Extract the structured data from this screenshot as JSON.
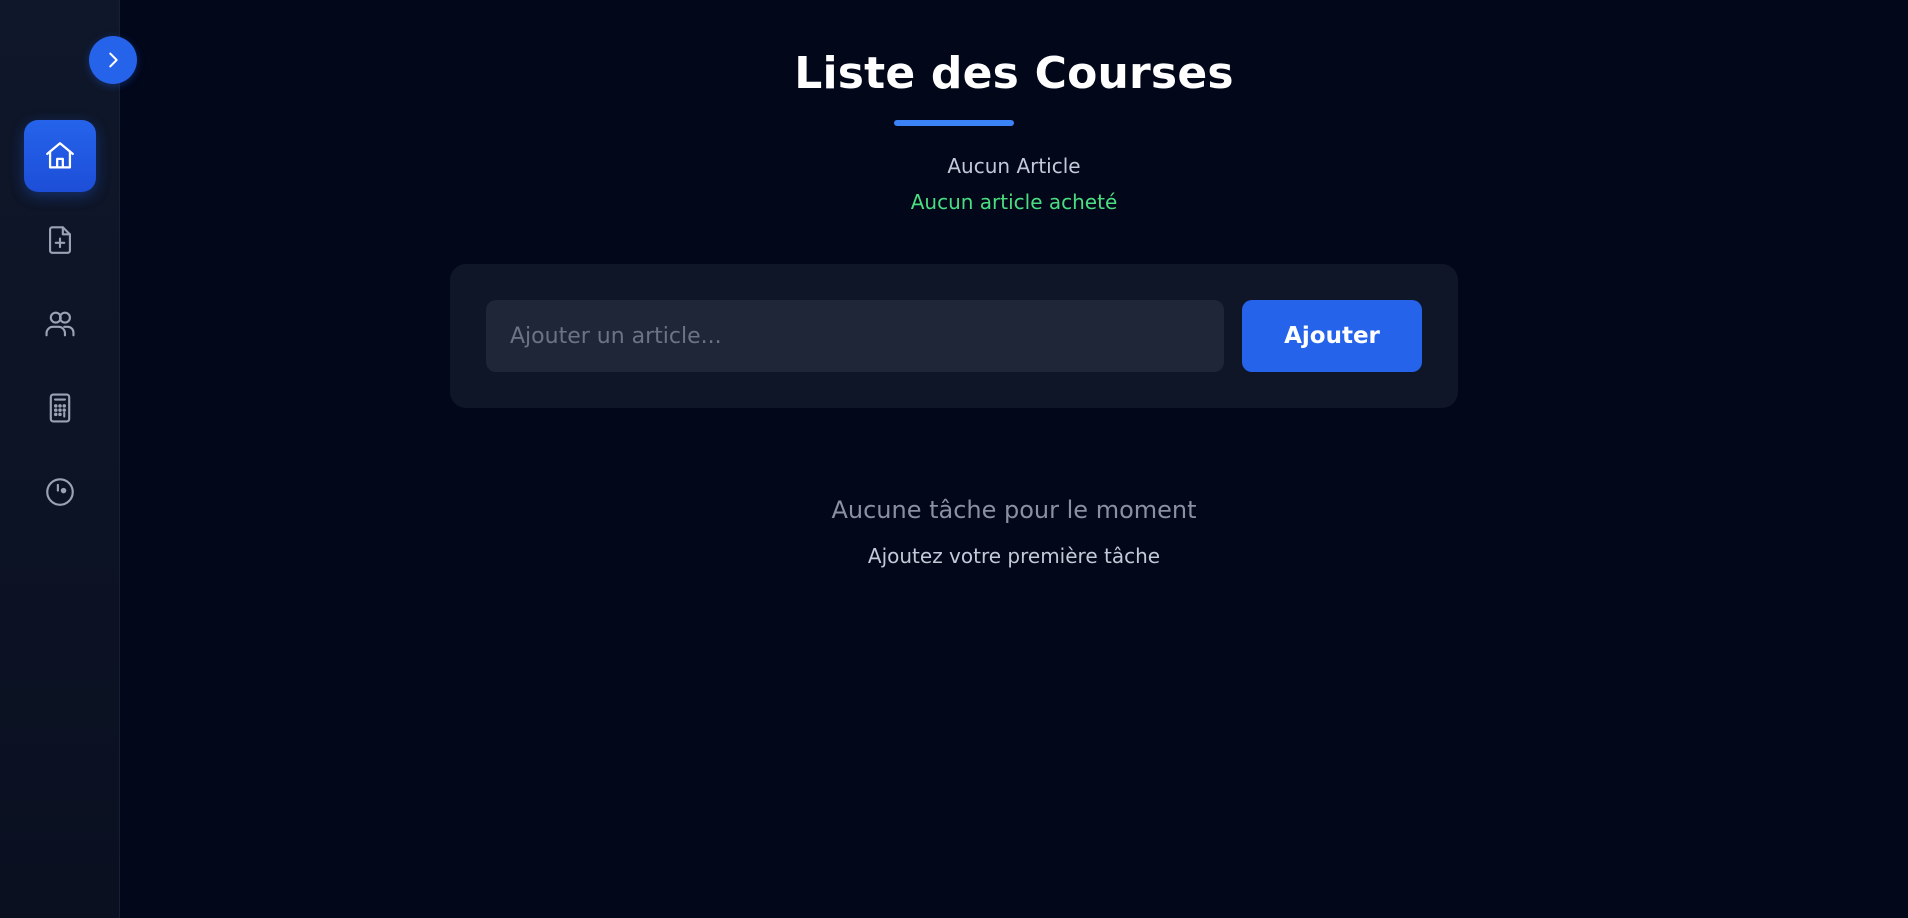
{
  "sidebar": {
    "toggle_icon": "chevron-right-icon",
    "items": [
      {
        "icon": "home-icon",
        "active": true
      },
      {
        "icon": "file-plus-icon",
        "active": false
      },
      {
        "icon": "users-icon",
        "active": false
      },
      {
        "icon": "calculator-icon",
        "active": false
      },
      {
        "icon": "gauge-icon",
        "active": false
      }
    ]
  },
  "main": {
    "title": "Liste des Courses",
    "count_text": "Aucun Article",
    "bought_text": "Aucun article acheté",
    "add_form": {
      "input_placeholder": "Ajouter un article...",
      "input_value": "",
      "button_label": "Ajouter"
    },
    "empty_state": {
      "title": "Aucune tâche pour le moment",
      "subtitle": "Ajoutez votre première tâche"
    }
  },
  "colors": {
    "background": "#02071a",
    "accent": "#2563eb",
    "success": "#4ade80"
  }
}
